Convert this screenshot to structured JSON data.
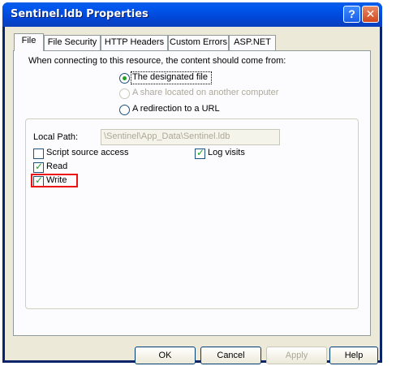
{
  "window": {
    "title": "Sentinel.ldb Properties",
    "help_glyph": "?",
    "close_glyph": "✕"
  },
  "tabs": [
    {
      "label": "File",
      "active": true
    },
    {
      "label": "File Security",
      "active": false
    },
    {
      "label": "HTTP Headers",
      "active": false
    },
    {
      "label": "Custom Errors",
      "active": false
    },
    {
      "label": "ASP.NET",
      "active": false
    }
  ],
  "content": {
    "intro": "When connecting to this resource, the content should come from:",
    "options": [
      {
        "label": "The designated file",
        "selected": true,
        "enabled": true
      },
      {
        "label": "A share located on another computer",
        "selected": false,
        "enabled": false
      },
      {
        "label": "A redirection to a URL",
        "selected": false,
        "enabled": true
      }
    ],
    "local_path_label": "Local Path:",
    "local_path_value": "\\Sentinel\\App_Data\\Sentinel.ldb",
    "checkboxes": {
      "script_source_access": {
        "label": "Script source access",
        "checked": false
      },
      "log_visits": {
        "label": "Log visits",
        "checked": true
      },
      "read": {
        "label": "Read",
        "checked": true
      },
      "write": {
        "label": "Write",
        "checked": true
      }
    }
  },
  "buttons": {
    "ok": "OK",
    "cancel": "Cancel",
    "apply": "Apply",
    "help": "Help"
  },
  "colors": {
    "highlight_box": "#e11111",
    "titlebar": "#0058ee",
    "face": "#ece9d8"
  }
}
